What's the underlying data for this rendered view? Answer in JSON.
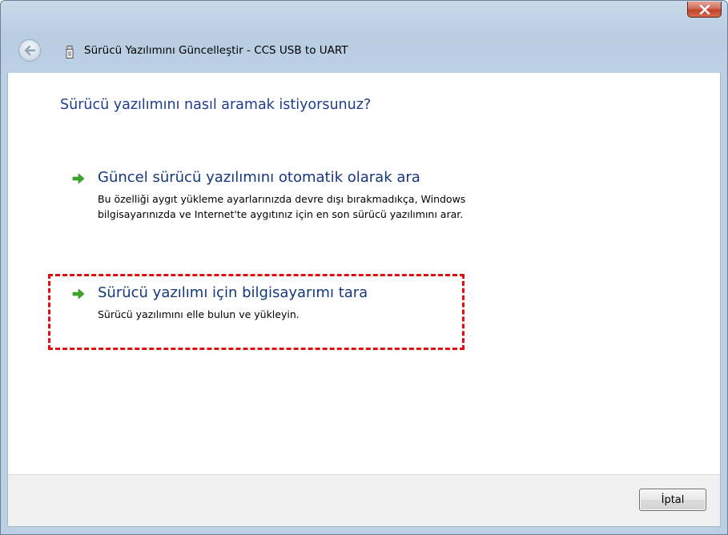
{
  "window": {
    "title": "Sürücü Yazılımını Güncelleştir - CCS USB to UART",
    "close_icon": "close-icon",
    "back_icon": "back-arrow-icon",
    "device_icon": "usb-device-icon"
  },
  "main": {
    "heading": "Sürücü yazılımını nasıl aramak istiyorsunuz?",
    "options": [
      {
        "title": "Güncel sürücü yazılımını otomatik olarak ara",
        "description_line1": "Bu özelliği aygıt yükleme ayarlarınızda devre dışı bırakmadıkça, Windows",
        "description_line2": "bilgisayarınızda ve Internet'te aygıtınız için en son sürücü yazılımını arar.",
        "icon": "green-arrow-icon"
      },
      {
        "title": "Sürücü yazılımı için bilgisayarımı tara",
        "description_line1": "Sürücü yazılımını elle bulun ve yükleyin.",
        "icon": "green-arrow-icon"
      }
    ]
  },
  "footer": {
    "cancel_label": "İptal"
  },
  "colors": {
    "heading": "#1f3d8c",
    "option_title": "#15377f",
    "arrow_green": "#3aa829",
    "highlight": "#e00f0f"
  }
}
